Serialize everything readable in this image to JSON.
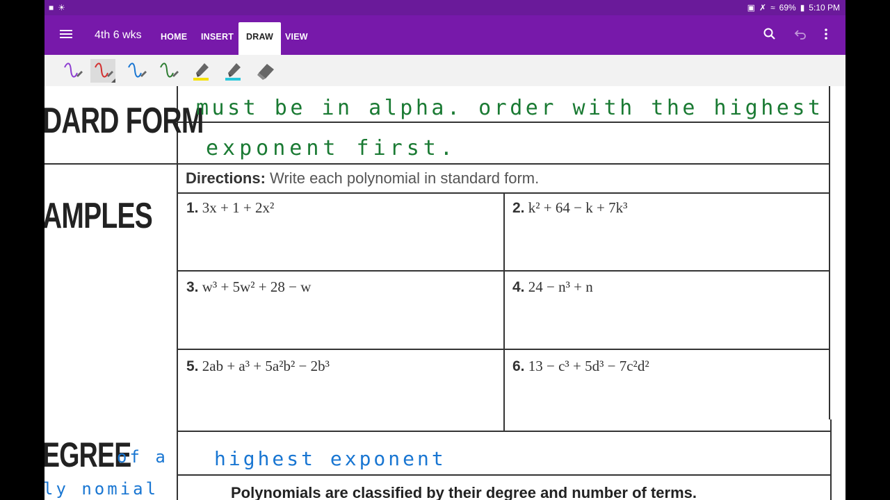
{
  "status": {
    "battery": "69%",
    "time": "5:10 PM"
  },
  "appbar": {
    "notebook_title": "4th 6 wks",
    "tabs": [
      "HOME",
      "INSERT",
      "DRAW",
      "VIEW"
    ],
    "active_tab": "DRAW"
  },
  "toolbar": {
    "pens": [
      {
        "name": "purple-pen",
        "color": "#8e3fd1"
      },
      {
        "name": "red-pen",
        "color": "#d32f2f"
      },
      {
        "name": "blue-pen",
        "color": "#1976d2"
      },
      {
        "name": "green-pen",
        "color": "#2e7d32"
      },
      {
        "name": "yellow-highlighter",
        "color": "#ffeb3b"
      },
      {
        "name": "cyan-highlighter",
        "color": "#26c6da"
      },
      {
        "name": "eraser",
        "color": "#555555"
      }
    ]
  },
  "page": {
    "side_labels": [
      "DARD FORM",
      "AMPLES",
      "EGREE"
    ],
    "directions_label": "Directions:",
    "directions_text": " Write each polynomial in standard form.",
    "problems": [
      {
        "num": "1.",
        "expr": "3x + 1 + 2x²"
      },
      {
        "num": "2.",
        "expr": "k² + 64 − k + 7k³"
      },
      {
        "num": "3.",
        "expr": "w³ + 5w² + 28 − w"
      },
      {
        "num": "4.",
        "expr": "24 − n³ + n"
      },
      {
        "num": "5.",
        "expr": "2ab + a³ + 5a²b² − 2b³"
      },
      {
        "num": "6.",
        "expr": "13 − c³ + 5d³ − 7c²d²"
      }
    ],
    "ink_green_1": "must be in alpha. order with the highest",
    "ink_green_2": "exponent first.",
    "ink_blue_1": "of a",
    "ink_blue_2": "highest exponent",
    "ink_blue_3": "ly nomial",
    "bottom_text": "Polynomials are classified by their degree and number of terms."
  }
}
